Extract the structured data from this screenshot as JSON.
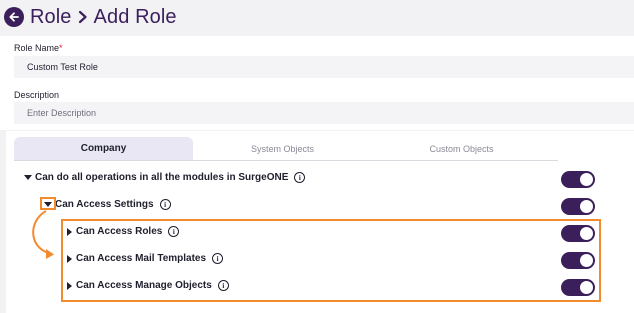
{
  "header": {
    "breadcrumb_parent": "Role",
    "breadcrumb_current": "Add Role"
  },
  "form": {
    "role_name_label": "Role Name",
    "required_marker": "*",
    "role_name_value": "Custom Test Role",
    "description_label": "Description",
    "description_placeholder": "Enter Description"
  },
  "tabs": [
    {
      "label": "Company",
      "active": true
    },
    {
      "label": "System Objects",
      "active": false
    },
    {
      "label": "Custom Objects",
      "active": false
    }
  ],
  "permissions": [
    {
      "label": "Can do all operations in all the modules in SurgeONE",
      "expanded": true,
      "enabled": true,
      "level": 0
    },
    {
      "label": "Can Access Settings",
      "expanded": true,
      "enabled": true,
      "level": 1
    },
    {
      "label": "Can Access Roles",
      "expanded": false,
      "enabled": true,
      "level": 2
    },
    {
      "label": "Can Access Mail Templates",
      "expanded": false,
      "enabled": true,
      "level": 2
    },
    {
      "label": "Can Access Manage Objects",
      "expanded": false,
      "enabled": true,
      "level": 2
    }
  ],
  "icons": {
    "back": "back-arrow-icon",
    "separator": "chevron-right-icon",
    "info": "info-icon",
    "expand": "caret-icon"
  },
  "colors": {
    "brand": "#3b1f5a",
    "annotation": "#f28a2e",
    "required": "#d8262c"
  }
}
